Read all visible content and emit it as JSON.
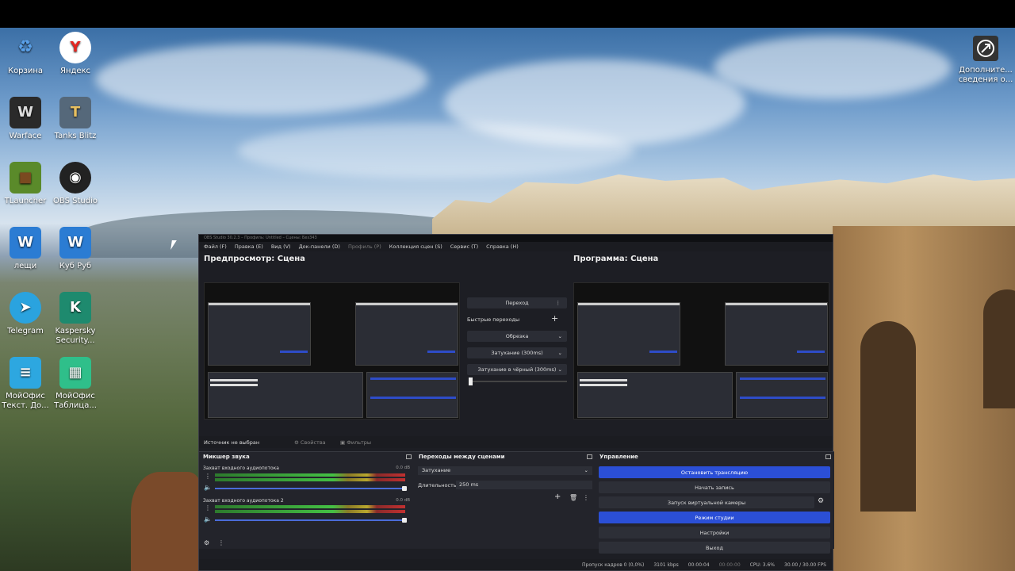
{
  "desktop": {
    "icons": [
      {
        "label": "Корзина",
        "icon": "recycle-bin-icon",
        "color": "#3a7bd5"
      },
      {
        "label": "Яндекс",
        "icon": "yandex-icon",
        "color": "#ffffff"
      },
      {
        "label": "Warface",
        "icon": "warface-icon",
        "color": "#2a2a2a"
      },
      {
        "label": "Tanks Blitz",
        "icon": "tanks-blitz-icon",
        "color": "#4a5a6a"
      },
      {
        "label": "TLauncher",
        "icon": "tlauncher-icon",
        "color": "#4a8a2a"
      },
      {
        "label": "OBS Studio",
        "icon": "obs-icon",
        "color": "#1e1e1e"
      },
      {
        "label": "лещи",
        "icon": "word-doc-icon",
        "color": "#2b7cd3"
      },
      {
        "label": "Куб Руб",
        "icon": "word-doc-icon",
        "color": "#2b7cd3"
      },
      {
        "label": "Telegram",
        "icon": "telegram-icon",
        "color": "#2aa3df"
      },
      {
        "label": "Kaspersky Security...",
        "icon": "kaspersky-icon",
        "color": "#1e8a6e"
      },
      {
        "label": "МойОфис Текст. До...",
        "icon": "myoffice-text-icon",
        "color": "#2da7e0"
      },
      {
        "label": "МойОфис Таблица...",
        "icon": "myoffice-table-icon",
        "color": "#2fbf8a"
      }
    ],
    "corner": {
      "label": "Дополните... сведения о...",
      "icon": "info-icon"
    }
  },
  "obs": {
    "title": "OBS Studio 30.2.3 – Профиль: Untitled – Сцены: Без343",
    "menu": [
      "Файл (F)",
      "Правка (E)",
      "Вид (V)",
      "Док-панели (D)",
      "Профиль (P)",
      "Коллекция сцен (S)",
      "Сервис (T)",
      "Справка (H)"
    ],
    "preview_label": "Предпросмотр: Сцена",
    "program_label": "Программа: Сцена",
    "transition_button": "Переход",
    "quick_transitions": "Быстрые переходы",
    "cut_button": "Обрезка",
    "fade_button": "Затухание (300ms)",
    "fade_black_button": "Затухание в чёрный (300ms)",
    "source_status": "Источник не выбран",
    "properties": "Свойства",
    "filters": "Фильтры",
    "mixer": {
      "title": "Микшер звука",
      "tracks": [
        {
          "name": "Захват входного аудиопотока",
          "db": "0.0 dB"
        },
        {
          "name": "Захват входного аудиопотока 2",
          "db": "0.0 dB"
        }
      ]
    },
    "transitions": {
      "title": "Переходы между сценами",
      "selected": "Затухание",
      "duration_label": "Длительность",
      "duration_value": "250 ms"
    },
    "controls": {
      "title": "Управление",
      "stop_stream": "Остановить трансляцию",
      "start_record": "Начать запись",
      "virtual_cam": "Запуск виртуальной камеры",
      "studio_mode": "Режим студии",
      "settings": "Настройки",
      "exit": "Выход"
    },
    "status": {
      "dropped": "Пропуск кадров 0 (0,0%)",
      "bitrate": "3101 kbps",
      "stream_time": "00:00:04",
      "rec_time": "00:00:00",
      "cpu": "CPU: 3.6%",
      "fps": "30.00 / 30.00 FPS"
    },
    "colors": {
      "accent": "#2b4fd6",
      "bg": "#1d1e24"
    }
  }
}
